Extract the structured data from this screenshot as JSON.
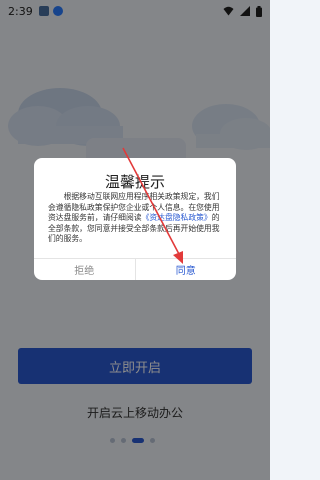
{
  "status_bar": {
    "time": "2:39"
  },
  "dialog": {
    "title": "温馨提示",
    "body_before": "根据移动互联网应用程序相关政策规定，我们会遵循隐私政策保护您企业或个人信息。在您使用资达盘服务前，请仔细阅读",
    "policy_link": "《资达盘隐私政策》",
    "body_after": "的全部条款，您同意并接受全部条款后再开始使用我们的服务。",
    "decline_label": "拒绝",
    "agree_label": "同意"
  },
  "main": {
    "start_button_label": "立即开启",
    "tagline": "开启云上移动办公"
  },
  "colors": {
    "accent": "#2a5ad1",
    "annotation_arrow": "#e23a3a"
  }
}
